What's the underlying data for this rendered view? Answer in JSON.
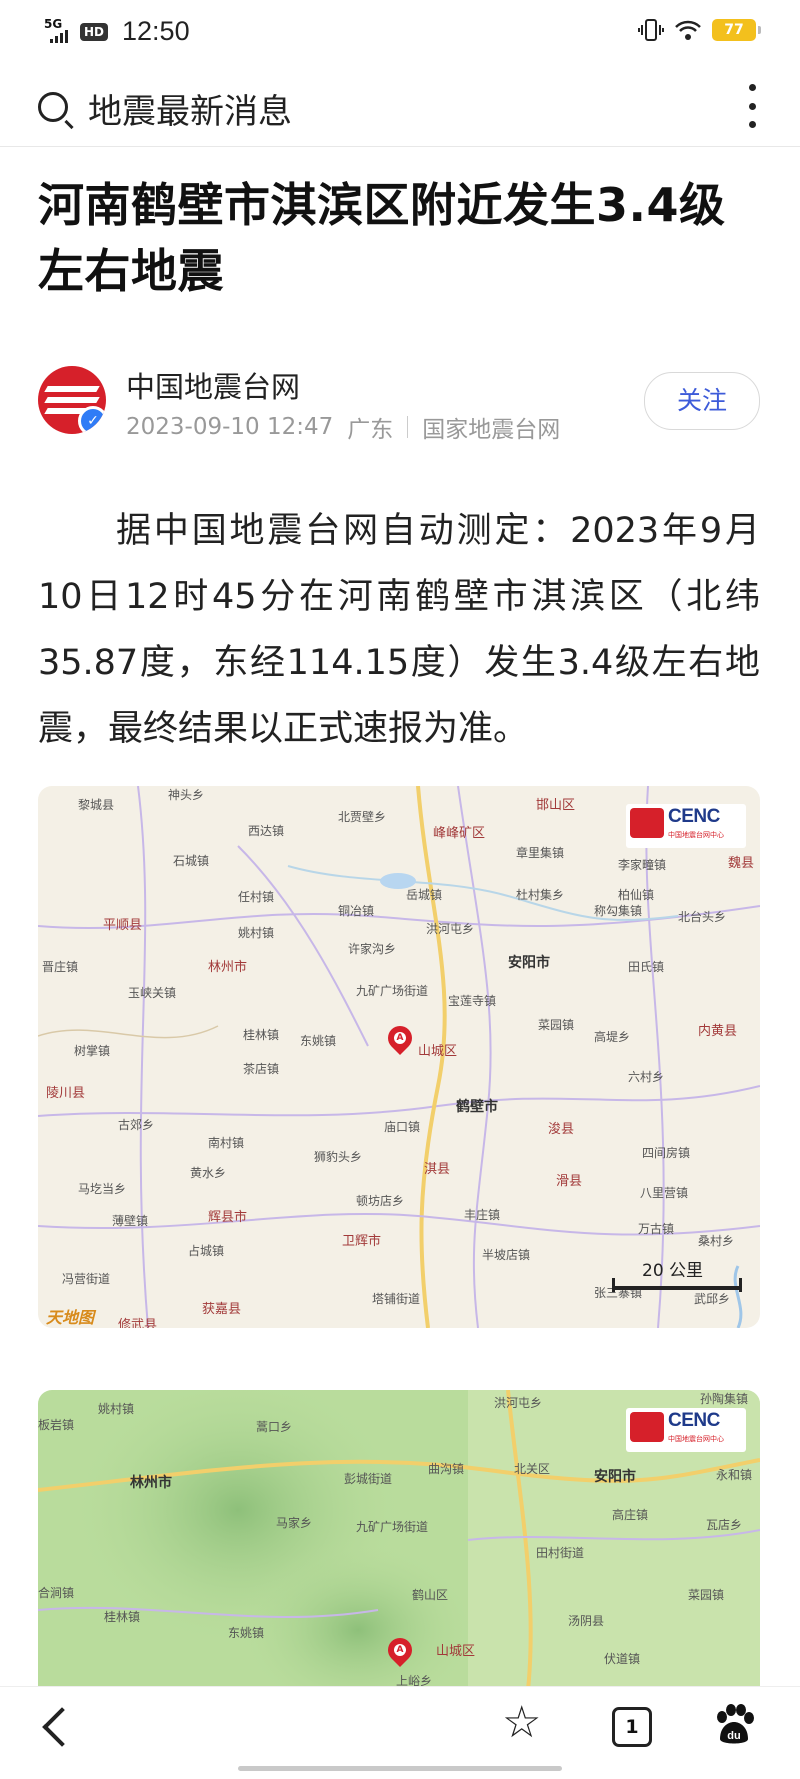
{
  "status_bar": {
    "network": "5G",
    "hd": "HD",
    "time": "12:50",
    "battery": "77"
  },
  "search": {
    "query": "地震最新消息"
  },
  "article": {
    "title": "河南鹤壁市淇滨区附近发生3.4级左右地震",
    "author": {
      "name": "中国地震台网",
      "date": "2023-09-10 12:47",
      "location": "广东",
      "source": "国家地震台网",
      "follow_label": "关注"
    },
    "body": "据中国地震台网自动测定：2023年9月10日12时45分在河南鹤壁市淇滨区（北纬35.87度，东经114.15度）发生3.4级左右地震，最终结果以正式速报为准。"
  },
  "map1": {
    "logo": "CENC",
    "logo_sub": "中国地震台网中心",
    "scale": "20 公里",
    "tianditu": "天地图",
    "places": [
      {
        "name": "黎城县"
      },
      {
        "name": "神头乡"
      },
      {
        "name": "西达镇"
      },
      {
        "name": "北贾壁乡"
      },
      {
        "name": "峰峰矿区"
      },
      {
        "name": "邯山区"
      },
      {
        "name": "石城镇"
      },
      {
        "name": "章里集镇"
      },
      {
        "name": "李家疃镇"
      },
      {
        "name": "魏县"
      },
      {
        "name": "岳城镇"
      },
      {
        "name": "任村镇"
      },
      {
        "name": "铜冶镇"
      },
      {
        "name": "杜村集乡"
      },
      {
        "name": "柏仙镇"
      },
      {
        "name": "称勾集镇"
      },
      {
        "name": "北台头乡"
      },
      {
        "name": "平顺县"
      },
      {
        "name": "姚村镇"
      },
      {
        "name": "洪河屯乡"
      },
      {
        "name": "许家沟乡"
      },
      {
        "name": "林州市"
      },
      {
        "name": "安阳市"
      },
      {
        "name": "田氏镇"
      },
      {
        "name": "晋庄镇"
      },
      {
        "name": "玉峡关镇"
      },
      {
        "name": "九矿广场街道"
      },
      {
        "name": "宝莲寺镇"
      },
      {
        "name": "桂林镇"
      },
      {
        "name": "东姚镇"
      },
      {
        "name": "菜园镇"
      },
      {
        "name": "内黄县"
      },
      {
        "name": "树掌镇"
      },
      {
        "name": "山城区"
      },
      {
        "name": "高堤乡"
      },
      {
        "name": "茶店镇"
      },
      {
        "name": "陵川县"
      },
      {
        "name": "鹤壁市"
      },
      {
        "name": "六村乡"
      },
      {
        "name": "古郊乡"
      },
      {
        "name": "庙口镇"
      },
      {
        "name": "浚县"
      },
      {
        "name": "南村镇"
      },
      {
        "name": "狮豹头乡"
      },
      {
        "name": "四间房镇"
      },
      {
        "name": "黄水乡"
      },
      {
        "name": "淇县"
      },
      {
        "name": "滑县"
      },
      {
        "name": "马圪当乡"
      },
      {
        "name": "八里营镇"
      },
      {
        "name": "薄壁镇"
      },
      {
        "name": "辉县市"
      },
      {
        "name": "顿坊店乡"
      },
      {
        "name": "丰庄镇"
      },
      {
        "name": "万古镇"
      },
      {
        "name": "占城镇"
      },
      {
        "name": "卫辉市"
      },
      {
        "name": "半坡店镇"
      },
      {
        "name": "桑村乡"
      },
      {
        "name": "冯营街道"
      },
      {
        "name": "张三寨镇"
      },
      {
        "name": "武邱乡"
      },
      {
        "name": "获嘉县"
      },
      {
        "name": "塔铺街道"
      },
      {
        "name": "修武县"
      }
    ]
  },
  "map2": {
    "logo": "CENC",
    "logo_sub": "中国地震台网中心",
    "places": [
      {
        "name": "姚村镇"
      },
      {
        "name": "洪河屯乡"
      },
      {
        "name": "孙陶集镇"
      },
      {
        "name": "板岩镇"
      },
      {
        "name": "蒿口乡"
      },
      {
        "name": "林州市"
      },
      {
        "name": "彭城街道"
      },
      {
        "name": "曲沟镇"
      },
      {
        "name": "北关区"
      },
      {
        "name": "安阳市"
      },
      {
        "name": "永和镇"
      },
      {
        "name": "马家乡"
      },
      {
        "name": "九矿广场街道"
      },
      {
        "name": "高庄镇"
      },
      {
        "name": "瓦店乡"
      },
      {
        "name": "田村街道"
      },
      {
        "name": "合涧镇"
      },
      {
        "name": "桂林镇"
      },
      {
        "name": "鹤山区"
      },
      {
        "name": "菜园镇"
      },
      {
        "name": "东姚镇"
      },
      {
        "name": "汤阴县"
      },
      {
        "name": "山城区"
      },
      {
        "name": "伏道镇"
      },
      {
        "name": "上峪乡"
      }
    ]
  }
}
